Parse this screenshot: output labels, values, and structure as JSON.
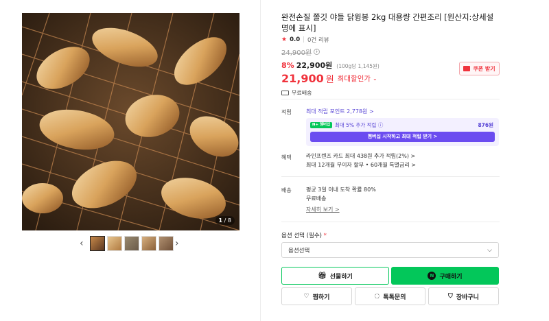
{
  "gallery": {
    "counter_current": "1",
    "counter_total": " / 8",
    "prev_arrow": "‹",
    "next_arrow": "›",
    "thumb_count": 5
  },
  "product": {
    "title": "완전손질 쫄깃 야들 닭윙봉 2kg 대용량 간편조리 [원산지:상세설명에 표시]",
    "rating": "0.0",
    "reviews": "0건 리뷰",
    "original_price": "24,900원",
    "discount_rate": "8%",
    "sale_price": "22,900원",
    "unit_price": "(100g당 1,145원)",
    "final_price": "21,900",
    "final_won": "원",
    "max_discount": "최대할인가",
    "coupon_label": "쿠폰 받기",
    "shipping_short": "무료배송"
  },
  "points": {
    "label": "적립",
    "max_points": "최대 적립 포인트 2,778원 >",
    "np_badge": "N+ 멤버십",
    "np_text": "최대 5% 추가 적립 ⓘ",
    "np_amount": "876원",
    "np_button": "멤버십 시작하고 최대 적립 받기 >"
  },
  "benefit": {
    "label": "혜택",
    "line1": "라인프렌즈 카드 최대 438원 추가 적립(2%) >",
    "line2": "최대 12개월 무이자 할부 • 60개월 특별금리 >"
  },
  "delivery": {
    "label": "배송",
    "line1": "평균 3일 이내 도착 확률 80%",
    "line2": "무료배송",
    "detail_link": "자세히 보기 >"
  },
  "options": {
    "label": "옵션 선택 (필수)",
    "required_mark": "*",
    "select_value": "옵션선택"
  },
  "actions": {
    "gift": "선물하기",
    "buy": "구매하기",
    "wish": "찜하기",
    "talk": "톡톡문의",
    "cart": "장바구니"
  },
  "colors": {
    "accent_red": "#f0323c",
    "naver_green": "#03c75a",
    "membership_purple": "#6b4cf0"
  }
}
